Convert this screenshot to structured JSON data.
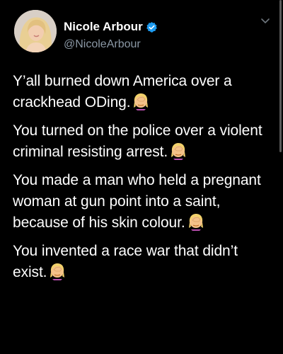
{
  "author": {
    "display_name": "Nicole Arbour",
    "handle": "@NicoleArbour",
    "verified": true,
    "avatar_icon": "profile-photo"
  },
  "tweet": {
    "paragraphs": [
      {
        "text": "Y’all burned down America over a crackhead ODing.",
        "emoji": "woman-facepalming-icon"
      },
      {
        "text": "You turned on the police over a violent criminal resisting arrest.",
        "emoji": "woman-facepalming-icon"
      },
      {
        "text": "You made a man who held a pregnant woman at gun point into a saint, because of his skin colour.",
        "emoji": "woman-facepalming-icon"
      },
      {
        "text": "You invented a race war that didn’t exist.",
        "emoji": "woman-facepalming-icon"
      }
    ]
  },
  "colors": {
    "background": "#000000",
    "text": "#ffffff",
    "secondary_text": "#8b98a5",
    "verified_badge": "#1d9bf0"
  }
}
